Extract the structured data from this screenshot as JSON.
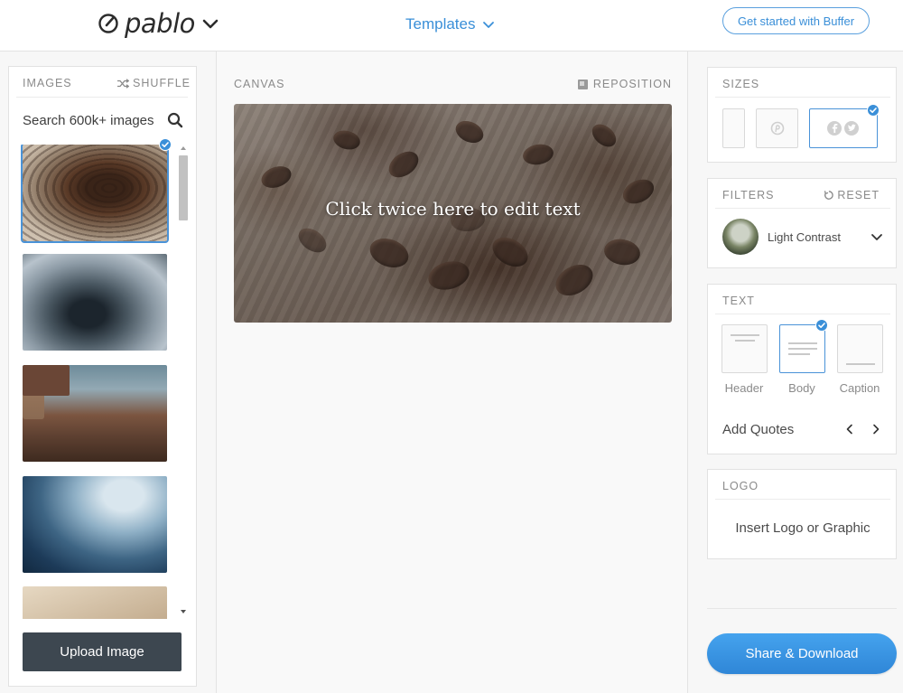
{
  "header": {
    "logo_text": "pablo",
    "templates_label": "Templates",
    "cta_label": "Get started with Buffer"
  },
  "images_panel": {
    "label": "IMAGES",
    "shuffle_label": "SHUFFLE",
    "search_placeholder": "Search 600k+ images",
    "upload_label": "Upload Image",
    "selected_index": 0
  },
  "canvas_panel": {
    "label": "CANVAS",
    "reposition_label": "REPOSITION",
    "canvas_text": "Click twice here to edit text"
  },
  "sizes_panel": {
    "label": "SIZES",
    "selected_index": 2
  },
  "filters_panel": {
    "label": "FILTERS",
    "reset_label": "RESET",
    "selected_filter": "Light Contrast"
  },
  "text_panel": {
    "label": "TEXT",
    "styles": [
      "Header",
      "Body",
      "Caption"
    ],
    "selected_index": 1,
    "quotes_label": "Add Quotes"
  },
  "logo_panel": {
    "label": "LOGO",
    "insert_label": "Insert Logo or Graphic"
  },
  "share_label": "Share & Download",
  "colors": {
    "accent": "#3a8fd8",
    "share_button": "#3896e3",
    "upload_button": "#3d4750",
    "label_grey": "#8a8a8a"
  },
  "icons": [
    "pablo-logo-icon",
    "chevron-down-icon",
    "shuffle-icon",
    "search-icon",
    "check-badge-icon",
    "reposition-icon",
    "reset-icon",
    "facebook-icon",
    "twitter-icon",
    "pinterest-icon",
    "chevron-left-icon",
    "chevron-right-icon"
  ]
}
